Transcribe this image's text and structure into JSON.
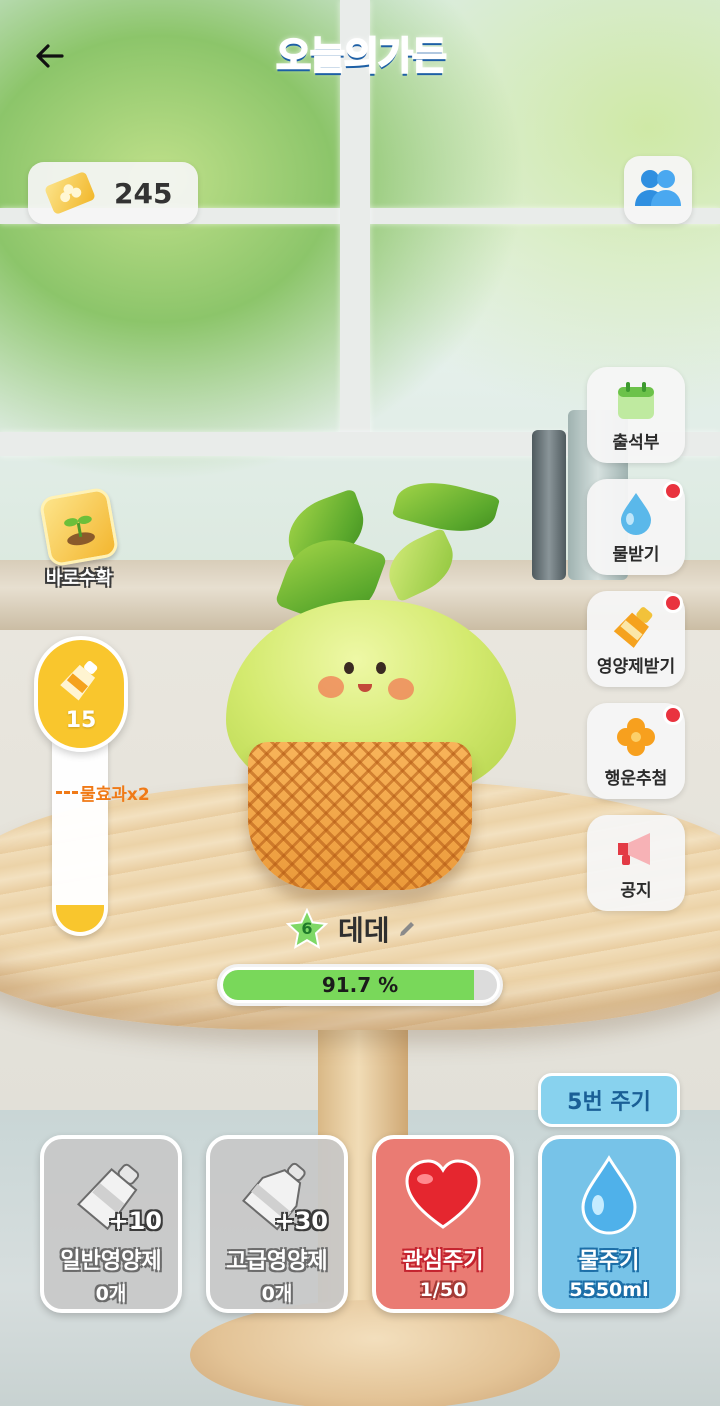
{
  "header": {
    "back_icon": "arrow-left-icon",
    "logo_text": "오늘의가든"
  },
  "currency": {
    "icon": "clover-ticket-icon",
    "value": "245"
  },
  "friends": {
    "icon": "people-icon"
  },
  "side_menu": [
    {
      "label": "출석부",
      "icon": "calendar-icon",
      "badge": false
    },
    {
      "label": "물받기",
      "icon": "water-drop-icon",
      "badge": true
    },
    {
      "label": "영양제받기",
      "icon": "nutrient-bottle-icon",
      "badge": true
    },
    {
      "label": "행운추첨",
      "icon": "clover-icon",
      "badge": true
    },
    {
      "label": "공지",
      "icon": "megaphone-icon",
      "badge": false
    }
  ],
  "harvest": {
    "label": "바로수확",
    "icon": "sprout-tile-icon"
  },
  "gauge": {
    "count": "15",
    "mark_label": "물효과x2",
    "fill_fraction": 0.14
  },
  "plant": {
    "level": "6",
    "name": "데데",
    "progress_text": "91.7 %",
    "progress_value": 0.917
  },
  "times_pill": "5번 주기",
  "actions": [
    {
      "title": "일반영양제",
      "sub": "0개",
      "bonus": "+10",
      "icon": "nutrient-bottle-icon",
      "style": "gray"
    },
    {
      "title": "고급영양제",
      "sub": "0개",
      "bonus": "+30",
      "icon": "premium-nutrient-icon",
      "style": "gray"
    },
    {
      "title": "관심주기",
      "sub": "1/50",
      "bonus": "",
      "icon": "heart-icon",
      "style": "red"
    },
    {
      "title": "물주기",
      "sub": "5550ml",
      "bonus": "",
      "icon": "water-drop-icon",
      "style": "blue"
    }
  ],
  "colors": {
    "accent_yellow": "#f9c62d",
    "progress_green": "#79d85a",
    "badge_red": "#e9333f",
    "water_blue": "#77c3e8",
    "heart_red": "#ea7b73"
  }
}
